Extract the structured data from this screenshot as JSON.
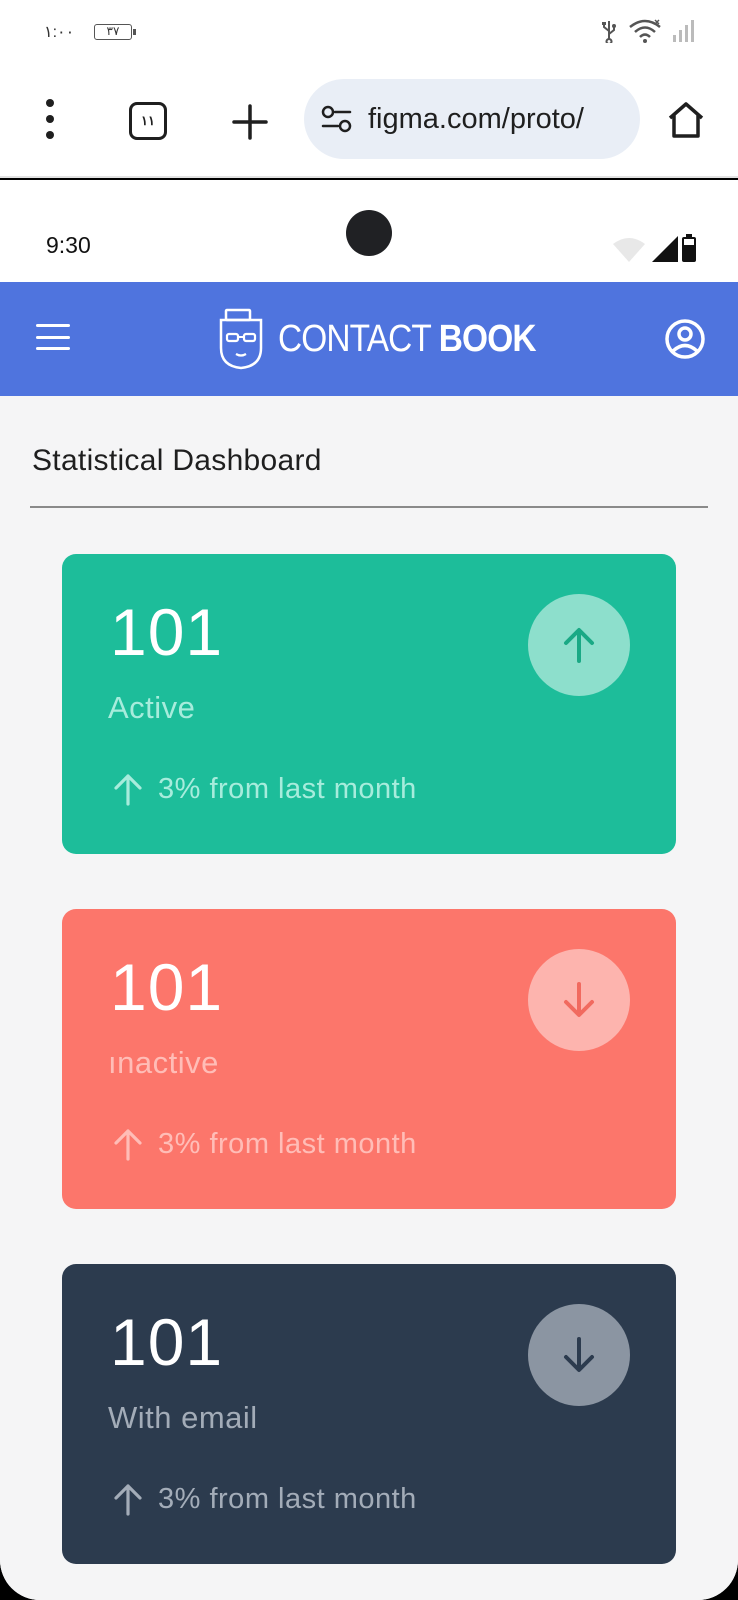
{
  "os_status": {
    "time": "١:٠٠",
    "battery": "٣٧"
  },
  "browser": {
    "tab_count": "١١",
    "url": "figma.com/proto/"
  },
  "device": {
    "time": "9:30"
  },
  "app": {
    "brand_light": "CONTACT ",
    "brand_bold": "BOOK"
  },
  "dashboard": {
    "title": "Statistical Dashboard",
    "cards": [
      {
        "value": "101",
        "label": "Active",
        "trend": "3% from last month",
        "direction": "up",
        "bg": "#1dbd9a",
        "badge_bg": "#8ddfcc",
        "badge_arrow": "#1aa985",
        "text_muted": "#a7ecdc"
      },
      {
        "value": "101",
        "label": "ınactive",
        "trend": "3% from last month",
        "direction": "down",
        "bg": "#fc766b",
        "badge_bg": "#fdb4ae",
        "badge_arrow": "#f16a5f",
        "text_muted": "#ffbdb7"
      },
      {
        "value": "101",
        "label": "With email",
        "trend": "3% from last month",
        "direction": "down",
        "bg": "#2c3b4e",
        "badge_bg": "#8b95a2",
        "badge_arrow": "#2c3b4e",
        "text_muted": "#a3acb8"
      }
    ]
  }
}
